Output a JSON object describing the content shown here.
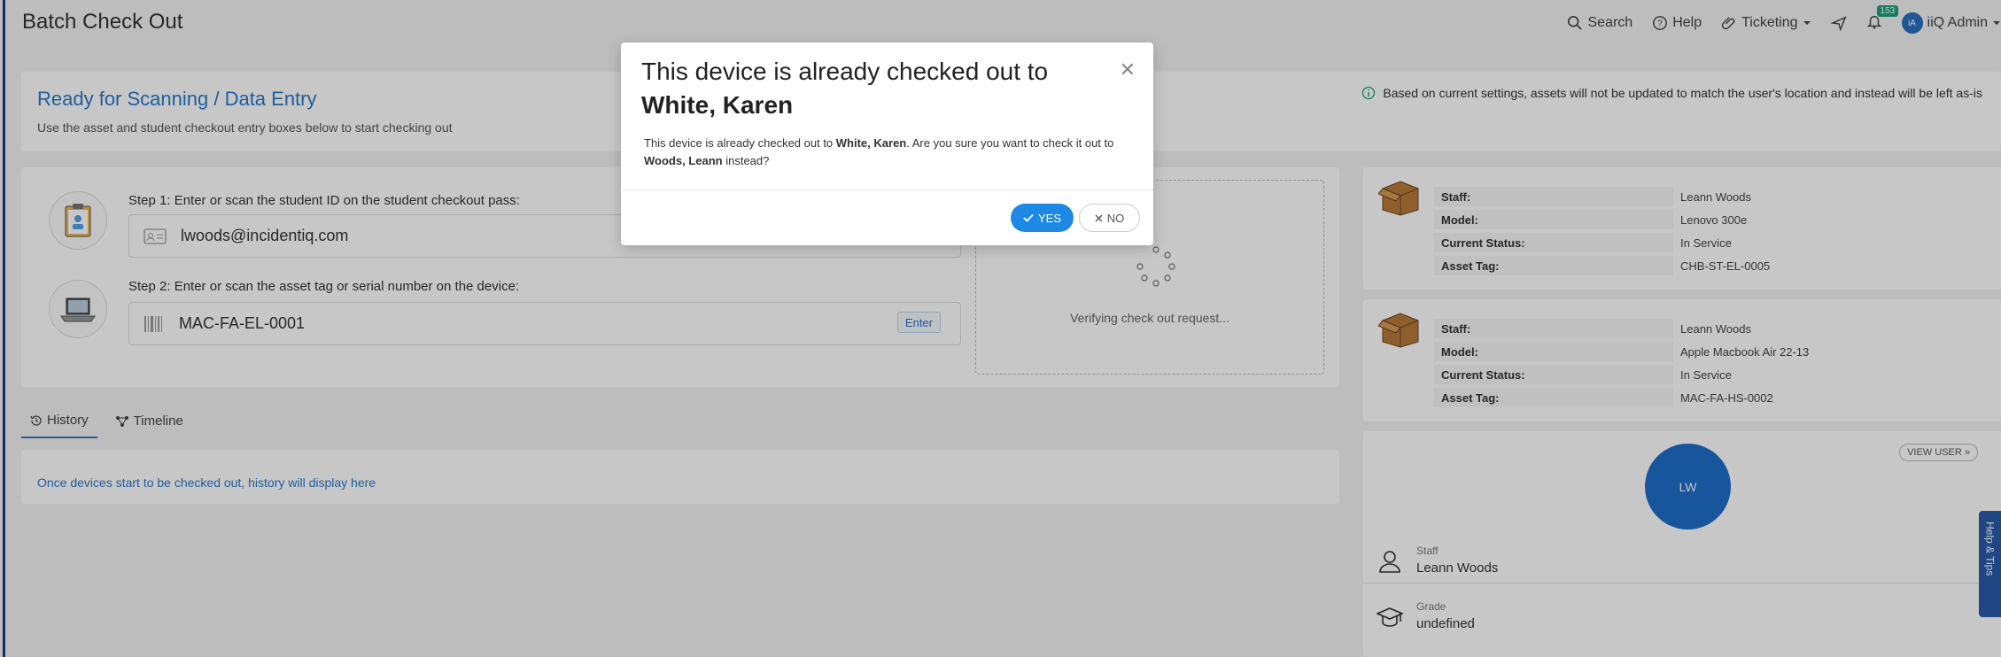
{
  "header": {
    "title": "Batch Check Out",
    "search_label": "Search",
    "help_label": "Help",
    "ticketing_label": "Ticketing",
    "notification_count": "153",
    "avatar_initials": "iA",
    "user_label": "iiQ Admin"
  },
  "ready": {
    "title": "Ready for Scanning / Data Entry",
    "subtitle": "Use the asset and student checkout entry boxes below to start checking out",
    "note": "Based on current settings, assets will not be updated to match the user's location and instead will be left as-is"
  },
  "entry": {
    "step1_label": "Step 1:  Enter or scan the student ID on the student checkout pass:",
    "step1_value": "lwoods@incidentiq.com",
    "step2_label": "Step 2:  Enter or scan the asset tag or serial number on the device:",
    "step2_value": "MAC-FA-EL-0001",
    "enter_label": "Enter",
    "verifying_text": "Verifying check out request..."
  },
  "tabs": {
    "history": "History",
    "timeline": "Timeline"
  },
  "history": {
    "empty_text": "Once devices start to be checked out, history will display here"
  },
  "assets": [
    {
      "staff_key": "Staff:",
      "staff": "Leann Woods",
      "model_key": "Model:",
      "model": "Lenovo 300e",
      "status_key": "Current Status:",
      "status": "In Service",
      "tag_key": "Asset Tag:",
      "tag": "CHB-ST-EL-0005"
    },
    {
      "staff_key": "Staff:",
      "staff": "Leann Woods",
      "model_key": "Model:",
      "model": "Apple Macbook Air 22-13",
      "status_key": "Current Status:",
      "status": "In Service",
      "tag_key": "Asset Tag:",
      "tag": "MAC-FA-HS-0002"
    }
  ],
  "user": {
    "initials": "LW",
    "view_user_label": "VIEW USER",
    "role_label": "Staff",
    "name": "Leann Woods",
    "grade_label": "Grade",
    "grade_value": "undefined"
  },
  "help_tab_label": "Help & Tips",
  "modal": {
    "title_prefix": "This device is already checked out to ",
    "title_name": "White, Karen",
    "body_prefix": "This device is already checked out to ",
    "body_name1": "White, Karen",
    "body_middle": ". Are you sure you want to check it out to ",
    "body_name2": "Woods, Leann",
    "body_suffix": " instead?",
    "yes_label": "YES",
    "no_label": "NO"
  }
}
